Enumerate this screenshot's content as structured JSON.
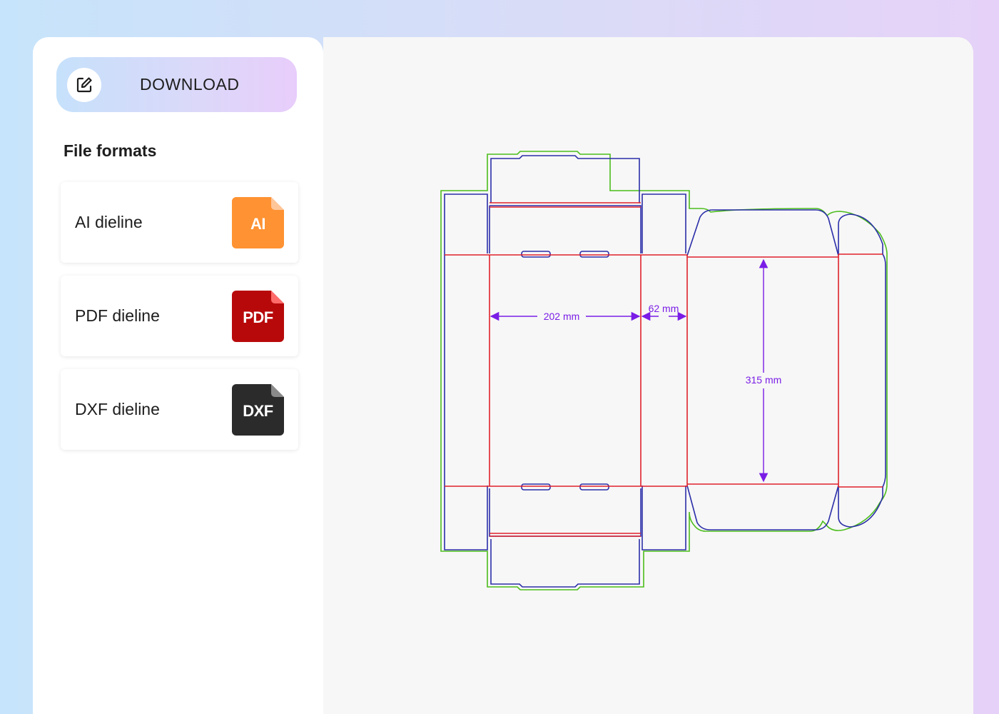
{
  "download": {
    "label": "DOWNLOAD",
    "icon": "edit-square-icon"
  },
  "file_formats": {
    "title": "File formats",
    "items": [
      {
        "label": "AI dieline",
        "badge": "AI",
        "color": "#ff9232"
      },
      {
        "label": "PDF dieline",
        "badge": "PDF",
        "color": "#b8090a"
      },
      {
        "label": "DXF dieline",
        "badge": "DXF",
        "color": "#2b2b2b"
      }
    ]
  },
  "dieline": {
    "dimensions": {
      "width": "202 mm",
      "depth": "62 mm",
      "length": "315 mm"
    },
    "colors": {
      "cut": "#2b2ea8",
      "crease": "#e0212b",
      "bleed": "#4cbd1c",
      "dimension": "#7a1de6"
    }
  }
}
